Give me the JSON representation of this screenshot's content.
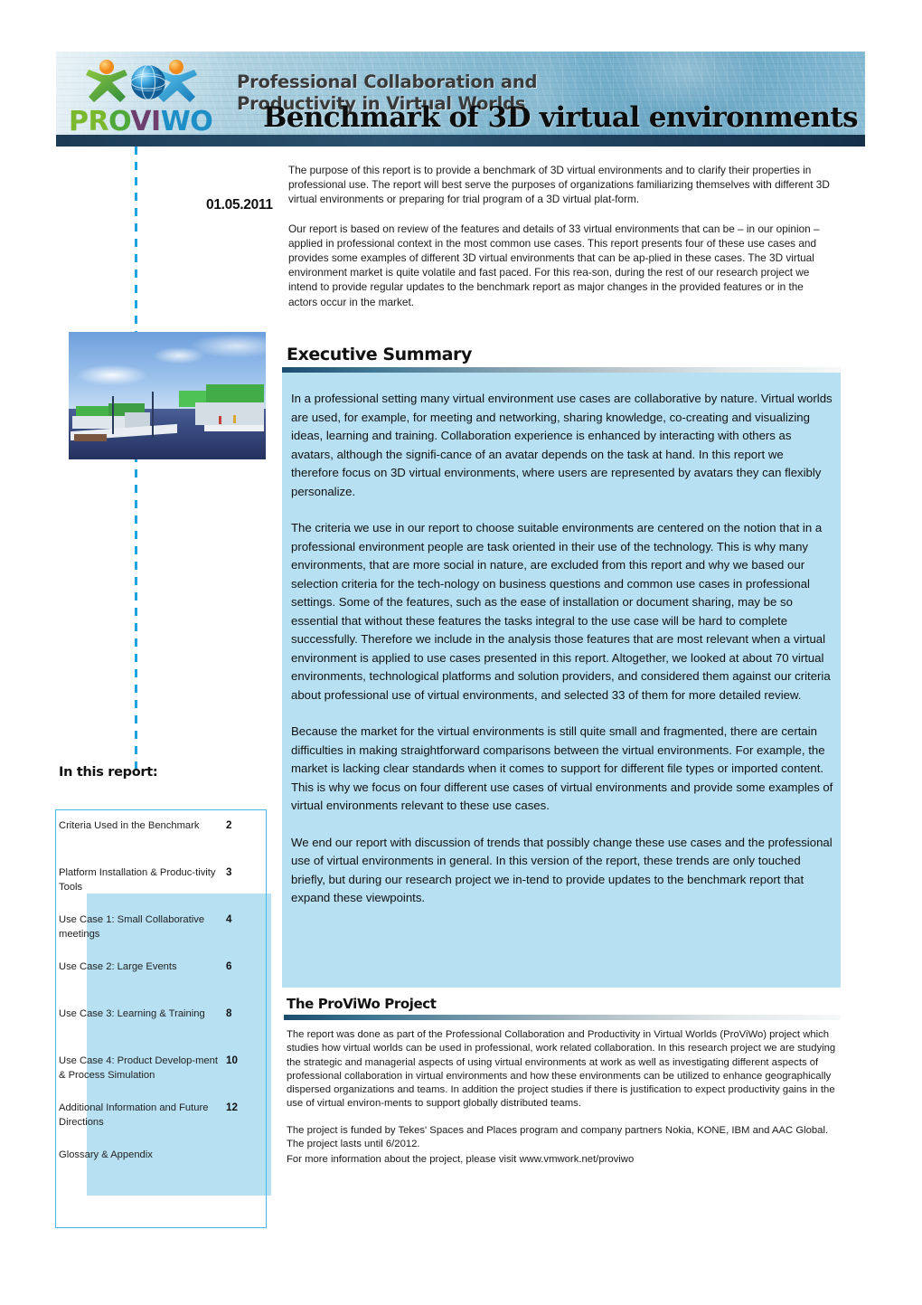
{
  "header": {
    "logo_wordmark": {
      "part1": "PR",
      "part2": "O",
      "part3": "VI",
      "part4": "WO"
    },
    "logo_alt": "proviwo-logo",
    "subtitle_line1": "Professional Collaboration and",
    "subtitle_line2": "Productivity in Virtual Worlds",
    "title": "Benchmark of 3D virtual environments"
  },
  "intro": {
    "date": "01.05.2011",
    "paragraphs": [
      "The purpose of this report is to provide a benchmark of 3D virtual environments and to clarify their properties in professional use. The report will best serve the purposes of organizations familiarizing themselves with different 3D virtual environments or preparing for trial program of a 3D virtual plat-form.",
      "Our report is based on review of the features and details of 33 virtual environments that can be – in our opinion – applied in professional context in the most common use cases. This report presents four of these use cases and provides some examples of different 3D virtual environments that can be ap-plied in these cases. The 3D virtual environment market is quite volatile and fast paced. For this rea-son, during the rest of our research project we intend to provide regular updates to the benchmark report as major changes in the provided features or in the actors occur in the market."
    ]
  },
  "illustration": {
    "caption": "virtual-world-scene"
  },
  "executive_summary": {
    "heading": "Executive Summary",
    "paragraphs": [
      "In a professional setting many virtual environment use cases are collaborative by nature. Virtual worlds are used, for example, for meeting and networking, sharing knowledge, co-creating and visualizing ideas, learning and training. Collaboration experience is enhanced by interacting with others as avatars, although the signifi-cance of an avatar depends on the task at hand. In this report we therefore focus on 3D virtual environments, where users are represented by avatars they can flexibly personalize.",
      "The criteria we use in our report to choose suitable environments are centered on the notion that in a professional environment people are task oriented in their use of the technology. This is why many environments, that are more social in nature, are excluded from this report and why we based our selection criteria for the tech-nology on business questions and common use cases in professional settings. Some of the features, such as the ease of installation or document sharing, may be so essential that without these features the tasks integral to the use case will be hard to complete successfully. Therefore we include in the analysis those features that are most relevant when a virtual environment is applied to use cases presented in this report. Altogether, we looked at about 70 virtual environments, technological platforms and solution providers, and considered them against our criteria about professional use of virtual environments, and selected 33 of them for more detailed review.",
      "Because the market for the virtual environments is still quite small and fragmented, there are certain difficulties in making straightforward comparisons between the virtual environments. For example, the market is lacking clear standards when it comes to support for different file types or imported content.  This is why we focus on four different use cases of virtual environments and provide some examples of virtual environments relevant to these use cases.",
      "We end our report with discussion of trends that possibly change these use cases and the professional use of virtual environments in general.  In this version of the report, these trends are only touched briefly, but during our research project we in-tend to provide updates to the benchmark report that expand these viewpoints."
    ]
  },
  "proviwo_project": {
    "heading": "The ProViWo Project",
    "paragraphs": [
      "The report was done as part of the Professional Collaboration and Productivity in Virtual Worlds (ProViWo) project which studies how virtual worlds can be used in professional, work related collaboration. In this research project we are studying the strategic and managerial aspects of using virtual environments at work as well as investigating different aspects of professional collaboration in virtual environments and how these environments can be utilized to enhance geographically dispersed organizations and teams. In addition the project studies if there is justification to expect productivity gains in the use of virtual environ-ments to support globally distributed teams.",
      "The project is funded by Tekes' Spaces and Places program and company partners Nokia, KONE, IBM and AAC Global. The project lasts until 6/2012.",
      "For more information about the project, please visit www.vmwork.net/proviwo"
    ]
  },
  "toc": {
    "heading": "In this report:",
    "items": [
      {
        "label": "Criteria Used in the Benchmark",
        "page": "2"
      },
      {
        "label": "Platform Installation & Produc-tivity Tools",
        "page": "3"
      },
      {
        "label": "Use Case 1: Small Collaborative meetings",
        "page": "4"
      },
      {
        "label": "Use Case 2: Large Events",
        "page": "6"
      },
      {
        "label": "Use Case 3: Learning & Training",
        "page": "8"
      },
      {
        "label": "Use Case 4: Product Develop-ment & Process Simulation",
        "page": "10"
      },
      {
        "label": "Additional Information and Future Directions",
        "page": "12"
      },
      {
        "label": "Glossary & Appendix",
        "page": ""
      }
    ]
  },
  "colors": {
    "accent_light_blue": "#b7e0f2",
    "accent_cyan_border": "#44b8e8",
    "banner_dark_band": "#1c3b55",
    "gradient_bar_start": "#1b4c6e",
    "dashed_line": "#1ba3e0"
  }
}
